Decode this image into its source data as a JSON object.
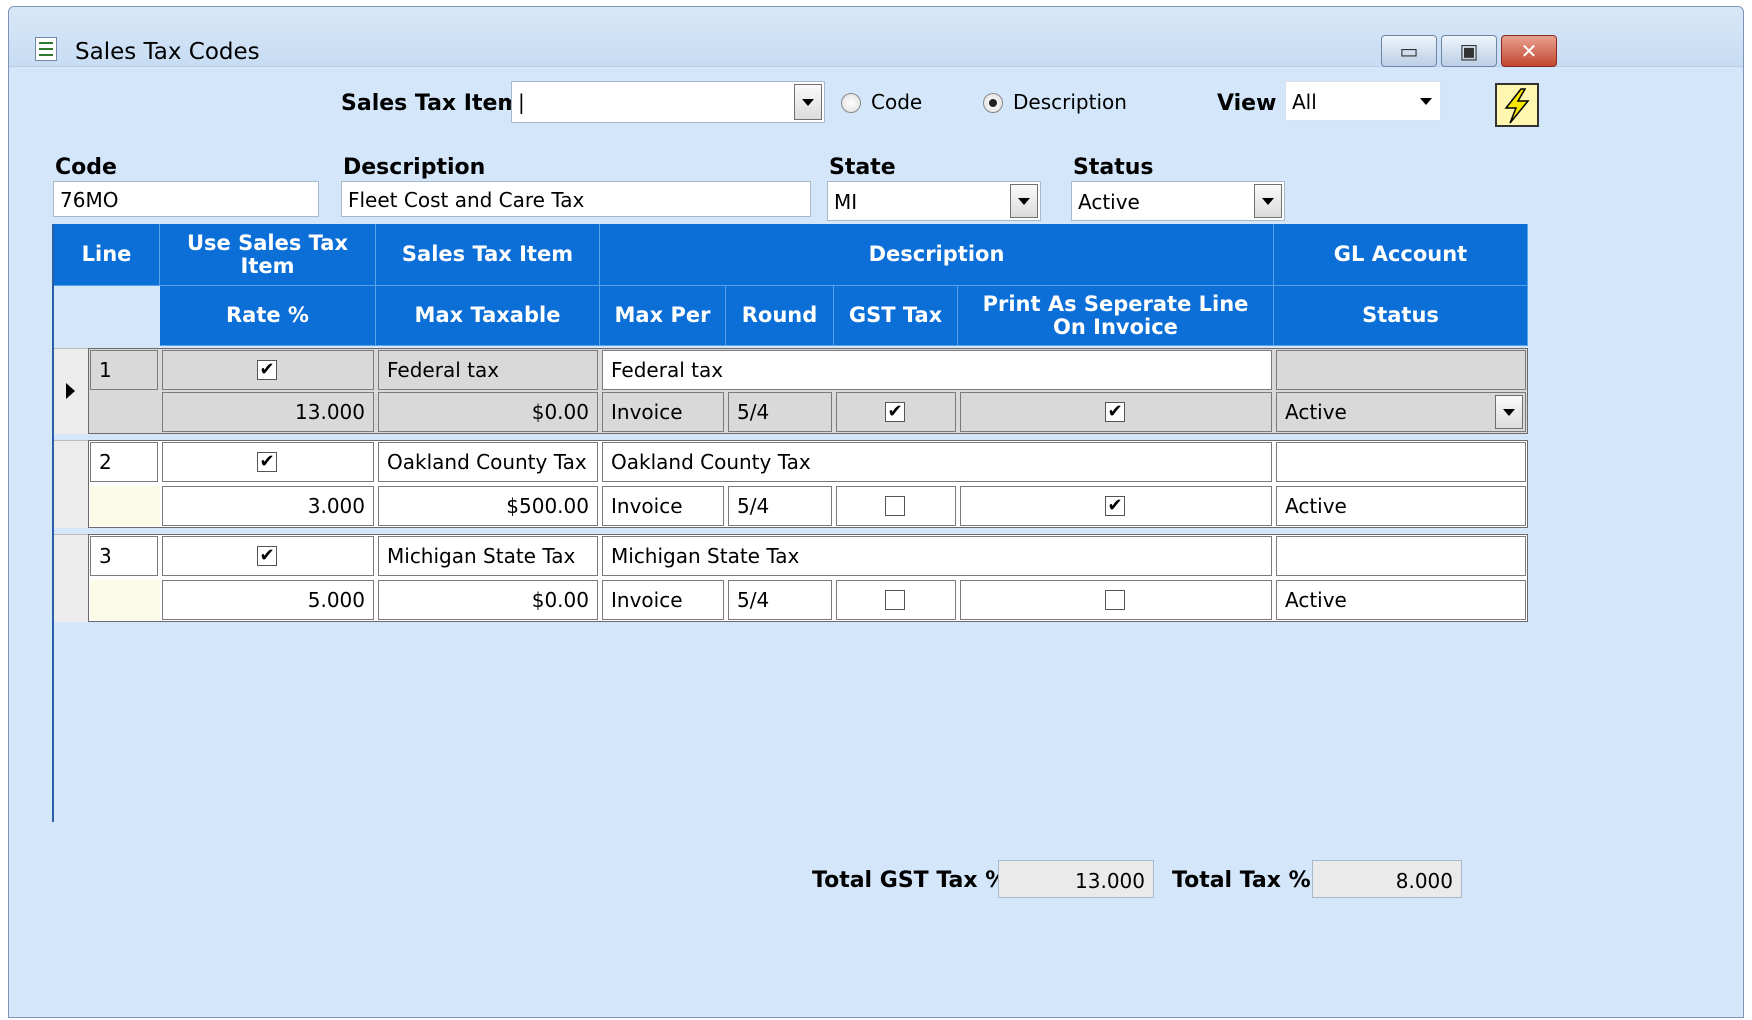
{
  "window": {
    "title": "Sales Tax Codes"
  },
  "search": {
    "label": "Sales Tax Item",
    "value": "|",
    "radio_code": "Code",
    "radio_description": "Description",
    "selected_radio": "Description",
    "view_label": "View",
    "view_value": "All"
  },
  "form": {
    "code_label": "Code",
    "code_value": "76MO",
    "description_label": "Description",
    "description_value": "Fleet Cost and Care Tax",
    "state_label": "State",
    "state_value": "MI",
    "status_label": "Status",
    "status_value": "Active"
  },
  "grid": {
    "headers_top": [
      "Line",
      "Use Sales Tax Item",
      "Sales Tax Item",
      "Description",
      "GL Account"
    ],
    "headers_bottom": [
      "Rate %",
      "Max Taxable",
      "Max Per",
      "Round",
      "GST Tax",
      "Print As Seperate Line On Invoice",
      "Status"
    ],
    "rows": [
      {
        "line": "1",
        "use_item": true,
        "item": "Federal tax",
        "description": "Federal tax",
        "gl_account": "",
        "rate": "13.000",
        "max_taxable": "$0.00",
        "max_per": "Invoice",
        "round": "5/4",
        "gst_tax": true,
        "print_separate": true,
        "status": "Active"
      },
      {
        "line": "2",
        "use_item": true,
        "item": "Oakland County Tax",
        "description": "Oakland County Tax",
        "gl_account": "",
        "rate": "3.000",
        "max_taxable": "$500.00",
        "max_per": "Invoice",
        "round": "5/4",
        "gst_tax": false,
        "print_separate": true,
        "status": "Active"
      },
      {
        "line": "3",
        "use_item": true,
        "item": "Michigan State Tax",
        "description": "Michigan State Tax",
        "gl_account": "",
        "rate": "5.000",
        "max_taxable": "$0.00",
        "max_per": "Invoice",
        "round": "5/4",
        "gst_tax": false,
        "print_separate": false,
        "status": "Active"
      }
    ]
  },
  "totals": {
    "gst_label": "Total GST Tax %",
    "gst_value": "13.000",
    "tax_label": "Total Tax %",
    "tax_value": "8.000"
  },
  "icons": {
    "app": "list-icon",
    "action": "lightning-icon"
  }
}
